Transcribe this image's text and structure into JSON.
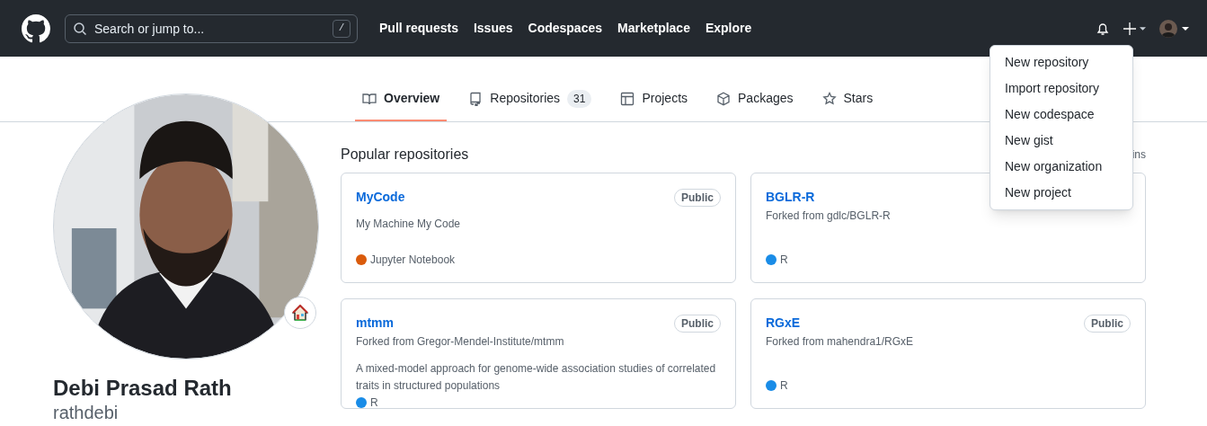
{
  "header": {
    "search": {
      "placeholder": "Search or jump to...",
      "shortcut": "/"
    },
    "nav": [
      "Pull requests",
      "Issues",
      "Codespaces",
      "Marketplace",
      "Explore"
    ]
  },
  "create_menu": {
    "items": [
      "New repository",
      "Import repository",
      "New codespace",
      "New gist",
      "New organization",
      "New project"
    ]
  },
  "tabs": [
    {
      "label": "Overview",
      "kind": "book",
      "selected": true
    },
    {
      "label": "Repositories",
      "kind": "repo",
      "counter": "31",
      "selected": false
    },
    {
      "label": "Projects",
      "kind": "table",
      "selected": false
    },
    {
      "label": "Packages",
      "kind": "package",
      "selected": false
    },
    {
      "label": "Stars",
      "kind": "star",
      "selected": false
    }
  ],
  "profile": {
    "name": "Debi Prasad Rath",
    "username": "rathdebi"
  },
  "popular": {
    "title": "Popular repositories",
    "pins_link": "ins",
    "repos": [
      {
        "name": "MyCode",
        "visibility": "Public",
        "description": "My Machine My Code",
        "language": {
          "name": "Jupyter Notebook",
          "color": "#da5b0b"
        }
      },
      {
        "name": "BGLR-R",
        "fork": "Forked from gdlc/BGLR-R",
        "language": {
          "name": "R",
          "color": "#198ce7"
        }
      },
      {
        "name": "mtmm",
        "visibility": "Public",
        "fork": "Forked from Gregor-Mendel-Institute/mtmm",
        "description": "A mixed-model approach for genome-wide association studies of correlated traits in structured populations",
        "language": {
          "name": "R",
          "color": "#198ce7"
        }
      },
      {
        "name": "RGxE",
        "visibility": "Public",
        "fork": "Forked from mahendra1/RGxE",
        "language": {
          "name": "R",
          "color": "#198ce7"
        }
      }
    ]
  }
}
